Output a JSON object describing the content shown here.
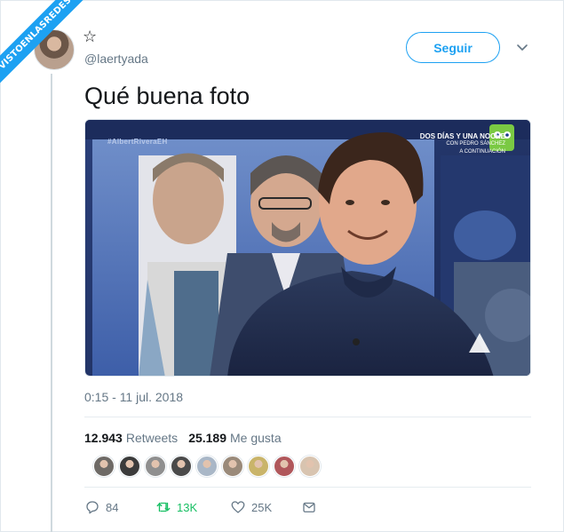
{
  "watermark": "VISTOENLASREDES",
  "author": {
    "display_name": "☆",
    "handle": "@laertyada"
  },
  "follow_label": "Seguir",
  "tweet": {
    "text": "Qué buena foto",
    "timestamp": "0:15 - 11 jul. 2018"
  },
  "media": {
    "tv_left": "#AlbertRiveraEH",
    "tv_right_title": "DOS DÍAS Y UNA NOCHE",
    "tv_right_sub1": "CON PEDRO SÁNCHEZ",
    "tv_right_sub2": "A CONTINUACIÓN"
  },
  "stats": {
    "retweets_count": "12.943",
    "retweets_label": "Retweets",
    "likes_count": "25.189",
    "likes_label": "Me gusta"
  },
  "likers_colors": [
    "#6e6a66",
    "#3b3b3b",
    "#8f8f8f",
    "#4a4a4a",
    "#a9b7c7",
    "#9a8a7a",
    "#c9b46a",
    "#b0575b",
    "#d8c4b0"
  ],
  "actions": {
    "reply_count": "84",
    "retweet_count": "13K",
    "like_count": "25K"
  },
  "colors": {
    "accent": "#1da1f2",
    "retweet": "#17bf63",
    "muted": "#657786"
  }
}
